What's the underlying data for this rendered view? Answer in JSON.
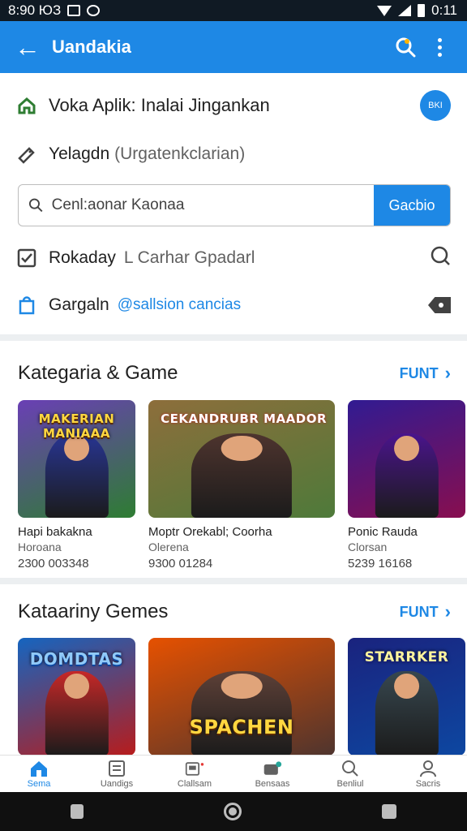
{
  "status_bar": {
    "time": "8:90 ЮЗ",
    "battery_text": "0:11"
  },
  "app_bar": {
    "title": "Uandakia"
  },
  "header": {
    "title": "Voka Aplik: Inalai Jingankan",
    "badge": "BKI",
    "row2_label": "Yelagdn",
    "row2_sub": "(Urgatenkclarian)",
    "search_placeholder": "Cenl:aonar Kaonaa",
    "search_button": "Gacbio",
    "row3_label": "Rokaday",
    "row3_muted": "L Carhar Gpadarl",
    "row4_label": "Gargaln",
    "row4_link": "@sallsion cancias"
  },
  "section1": {
    "title": "Kategaria & Game",
    "more": "FUNT",
    "games": [
      {
        "banner": "MAKERIAN MANIAAA",
        "title": "Hapi bakakna",
        "sub": "Horoana",
        "count": "2300 003348",
        "c1": "#6a3fb5",
        "c2": "#2e7d32",
        "fig": "#283593"
      },
      {
        "banner": "CEKANDRUBR MAADOR",
        "title": "Moptr Orekabl; Coorha",
        "sub": "Olerena",
        "count": "9300 01284",
        "c1": "#8d6e3b",
        "c2": "#4e7a3a",
        "fig": "#4e342e"
      },
      {
        "banner": "",
        "title": "Ponic Rauda",
        "sub": "Clorsan",
        "count": "5239 16168",
        "c1": "#311b92",
        "c2": "#880e4f",
        "fig": "#4a148c"
      }
    ]
  },
  "section2": {
    "title": "Kataariny Gemes",
    "more": "FUNT",
    "games": [
      {
        "banner": "DOMDTAS",
        "c1": "#1565c0",
        "c2": "#b71c1c",
        "fig": "#c62828"
      },
      {
        "banner": "SPACHEN",
        "c1": "#e65100",
        "c2": "#4e342e",
        "fig": "#5d4037"
      },
      {
        "banner": "STARRKER",
        "c1": "#1a237e",
        "c2": "#0d47a1",
        "fig": "#37474f"
      }
    ]
  },
  "bottom_nav": [
    {
      "label": "Sema",
      "active": true
    },
    {
      "label": "Uandigs"
    },
    {
      "label": "Clallsam"
    },
    {
      "label": "Bensaas"
    },
    {
      "label": "Benliul"
    },
    {
      "label": "Sacris"
    }
  ]
}
